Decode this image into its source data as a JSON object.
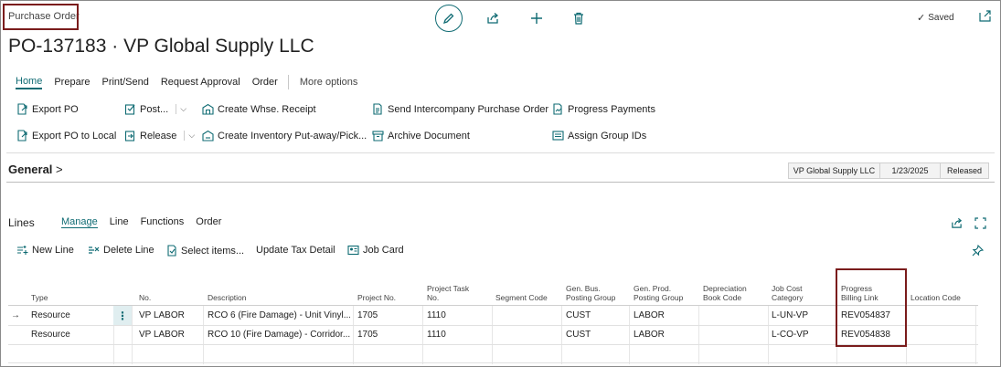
{
  "page": {
    "type_label": "Purchase Order",
    "title": "PO-137183 · VP Global Supply LLC",
    "status": "Saved"
  },
  "nav": {
    "tabs": [
      "Home",
      "Prepare",
      "Print/Send",
      "Request Approval",
      "Order"
    ],
    "more": "More options"
  },
  "actions": {
    "export_po": "Export PO",
    "export_po_local": "Export PO to Local",
    "post": "Post...",
    "release": "Release",
    "create_whse_receipt": "Create Whse. Receipt",
    "create_inventory_putaway": "Create Inventory Put-away/Pick...",
    "send_intercompany": "Send Intercompany Purchase Order",
    "archive_document": "Archive Document",
    "progress_payments": "Progress Payments",
    "assign_group_ids": "Assign Group IDs"
  },
  "general": {
    "label": "General",
    "vendor": "VP Global Supply LLC",
    "date": "1/23/2025",
    "status": "Released"
  },
  "lines": {
    "title": "Lines",
    "tabs": [
      "Manage",
      "Line",
      "Functions",
      "Order"
    ],
    "actions": {
      "new_line": "New Line",
      "delete_line": "Delete Line",
      "select_items": "Select items...",
      "update_tax": "Update Tax Detail",
      "job_card": "Job Card"
    },
    "columns": {
      "type": "Type",
      "no": "No.",
      "description": "Description",
      "project_no": "Project No.",
      "project_task_no": "Project Task No.",
      "segment_code": "Segment Code",
      "gen_bus": "Gen. Bus. Posting Group",
      "gen_prod": "Gen. Prod. Posting Group",
      "depreciation": "Depreciation Book Code",
      "job_cost": "Job Cost Category",
      "progress_billing": "Progress Billing Link",
      "location": "Location Code"
    },
    "rows": [
      {
        "type": "Resource",
        "no": "VP LABOR",
        "description": "RCO 6 (Fire Damage) - Unit Vinyl...",
        "project_no": "1705",
        "task": "1110",
        "gen_bus": "CUST",
        "gen_prod": "LABOR",
        "job_cost": "L-UN-VP",
        "billing": "REV054837"
      },
      {
        "type": "Resource",
        "no": "VP LABOR",
        "description": "RCO 10 (Fire Damage) - Corridor...",
        "project_no": "1705",
        "task": "1110",
        "gen_bus": "CUST",
        "gen_prod": "LABOR",
        "job_cost": "L-CO-VP",
        "billing": "REV054838"
      }
    ]
  },
  "colors": {
    "accent": "#0f6b73",
    "highlight": "#7a1c1c"
  }
}
